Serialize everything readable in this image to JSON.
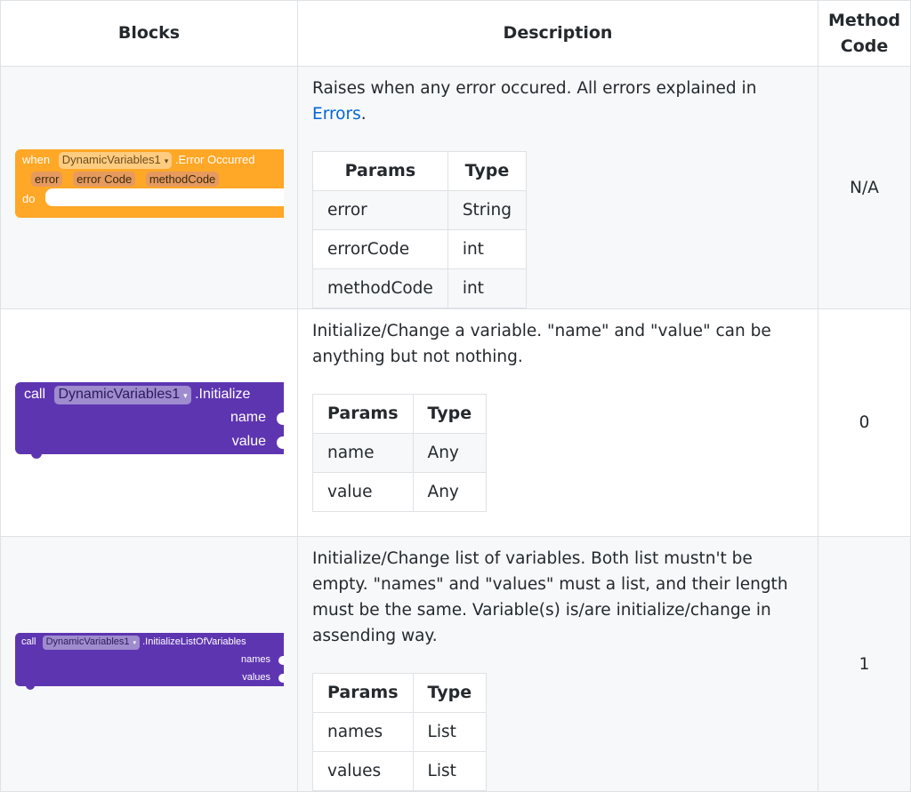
{
  "headers": {
    "blocks": "Blocks",
    "description": "Description",
    "method_code_line1": "Method",
    "method_code_line2": "Code"
  },
  "params_headers": {
    "params": "Params",
    "type": "Type"
  },
  "rows": [
    {
      "block": {
        "color": "#ffa726",
        "when": "when",
        "component": "DynamicVariables1",
        "event": ".Error Occurred",
        "params": [
          "error",
          "error Code",
          "methodCode"
        ],
        "do": "do"
      },
      "description_prefix": "Raises when any error occured. All errors explained in ",
      "description_link": "Errors",
      "description_suffix": ".",
      "params": [
        {
          "name": "error",
          "type": "String"
        },
        {
          "name": "errorCode",
          "type": "int"
        },
        {
          "name": "methodCode",
          "type": "int"
        }
      ],
      "method_code": "N/A"
    },
    {
      "block": {
        "color": "#5e35b1",
        "call": "call",
        "component": "DynamicVariables1",
        "method": ".Initialize",
        "sockets": [
          "name",
          "value"
        ]
      },
      "description": "Initialize/Change a variable. \"name\" and \"value\" can be anything but not nothing.",
      "params": [
        {
          "name": "name",
          "type": "Any"
        },
        {
          "name": "value",
          "type": "Any"
        }
      ],
      "method_code": "0"
    },
    {
      "block": {
        "color": "#5e35b1",
        "call": "call",
        "component": "DynamicVariables1",
        "method": ".InitializeListOfVariables",
        "sockets": [
          "names",
          "values"
        ]
      },
      "description": "Initialize/Change list of variables. Both list mustn't be empty. \"names\" and \"values\" must a list, and their length must be the same. Variable(s) is/are initialize/change in assending way.",
      "params": [
        {
          "name": "names",
          "type": "List"
        },
        {
          "name": "values",
          "type": "List"
        }
      ],
      "method_code": "1"
    }
  ]
}
